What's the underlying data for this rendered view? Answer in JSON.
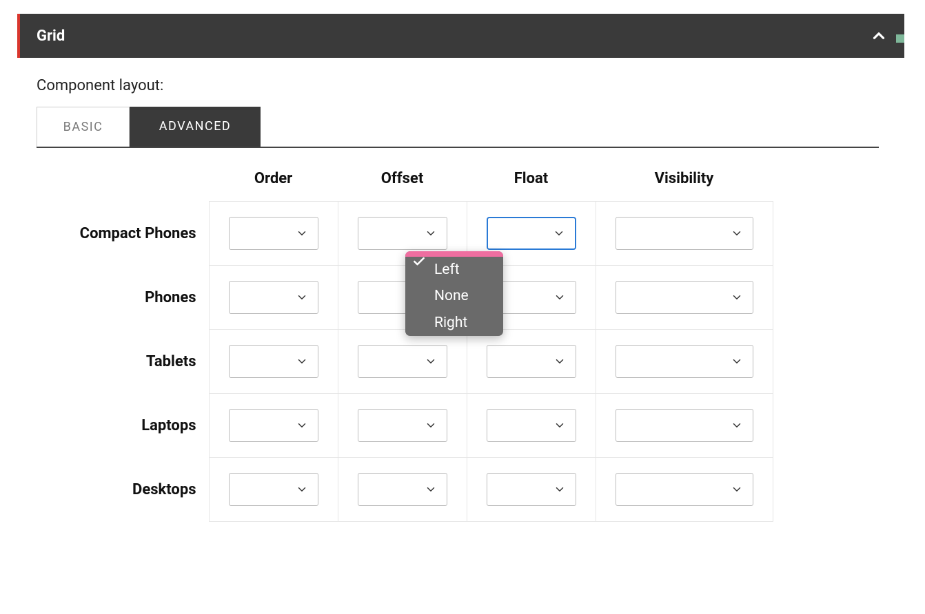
{
  "panel": {
    "title": "Grid",
    "section_label": "Component layout:"
  },
  "tabs": {
    "basic": "BASIC",
    "advanced": "ADVANCED"
  },
  "columns": [
    "Order",
    "Offset",
    "Float",
    "Visibility"
  ],
  "rows": [
    "Compact Phones",
    "Phones",
    "Tablets",
    "Laptops",
    "Desktops"
  ],
  "float_dropdown": {
    "options": [
      "",
      "Left",
      "None",
      "Right"
    ],
    "selected_index": 0
  }
}
